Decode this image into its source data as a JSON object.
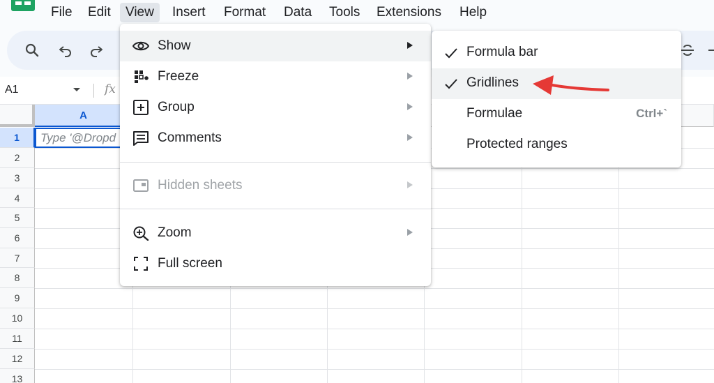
{
  "menubar": {
    "items": [
      {
        "label": "File"
      },
      {
        "label": "Edit"
      },
      {
        "label": "View"
      },
      {
        "label": "Insert"
      },
      {
        "label": "Format"
      },
      {
        "label": "Data"
      },
      {
        "label": "Tools"
      },
      {
        "label": "Extensions"
      },
      {
        "label": "Help"
      }
    ],
    "active_item": "View"
  },
  "toolbar": {
    "icons": [
      "search-icon",
      "undo-icon",
      "redo-icon",
      "strikethrough-icon"
    ]
  },
  "formula_bar": {
    "name_box": "A1",
    "fx_label": "fx"
  },
  "grid": {
    "columns": [
      "A"
    ],
    "selected_column": "A",
    "rows": [
      "1",
      "2",
      "3",
      "4",
      "5",
      "6",
      "7",
      "8",
      "9",
      "10",
      "11",
      "12",
      "13"
    ],
    "selected_row": "1",
    "active_cell_placeholder": "Type '@Dropd"
  },
  "view_menu": {
    "items": [
      {
        "label": "Show",
        "icon": "eye-icon",
        "has_submenu": true,
        "highlighted": true
      },
      {
        "label": "Freeze",
        "icon": "freeze-grid-icon",
        "has_submenu": true
      },
      {
        "label": "Group",
        "icon": "group-plus-icon",
        "has_submenu": true
      },
      {
        "label": "Comments",
        "icon": "comment-icon",
        "has_submenu": true
      },
      {
        "label": "Hidden sheets",
        "icon": "hidden-sheet-icon",
        "has_submenu": true,
        "disabled": true
      },
      {
        "label": "Zoom",
        "icon": "zoom-icon",
        "has_submenu": true
      },
      {
        "label": "Full screen",
        "icon": "fullscreen-icon",
        "has_submenu": false
      }
    ]
  },
  "show_submenu": {
    "items": [
      {
        "label": "Formula bar",
        "checked": true
      },
      {
        "label": "Gridlines",
        "checked": true,
        "highlighted": true
      },
      {
        "label": "Formulae",
        "checked": false,
        "shortcut": "Ctrl+`"
      },
      {
        "label": "Protected ranges",
        "checked": false
      }
    ]
  },
  "colors": {
    "brand_green": "#1ea362",
    "selection_blue": "#0b57d0",
    "annotation_red": "#e53935"
  }
}
